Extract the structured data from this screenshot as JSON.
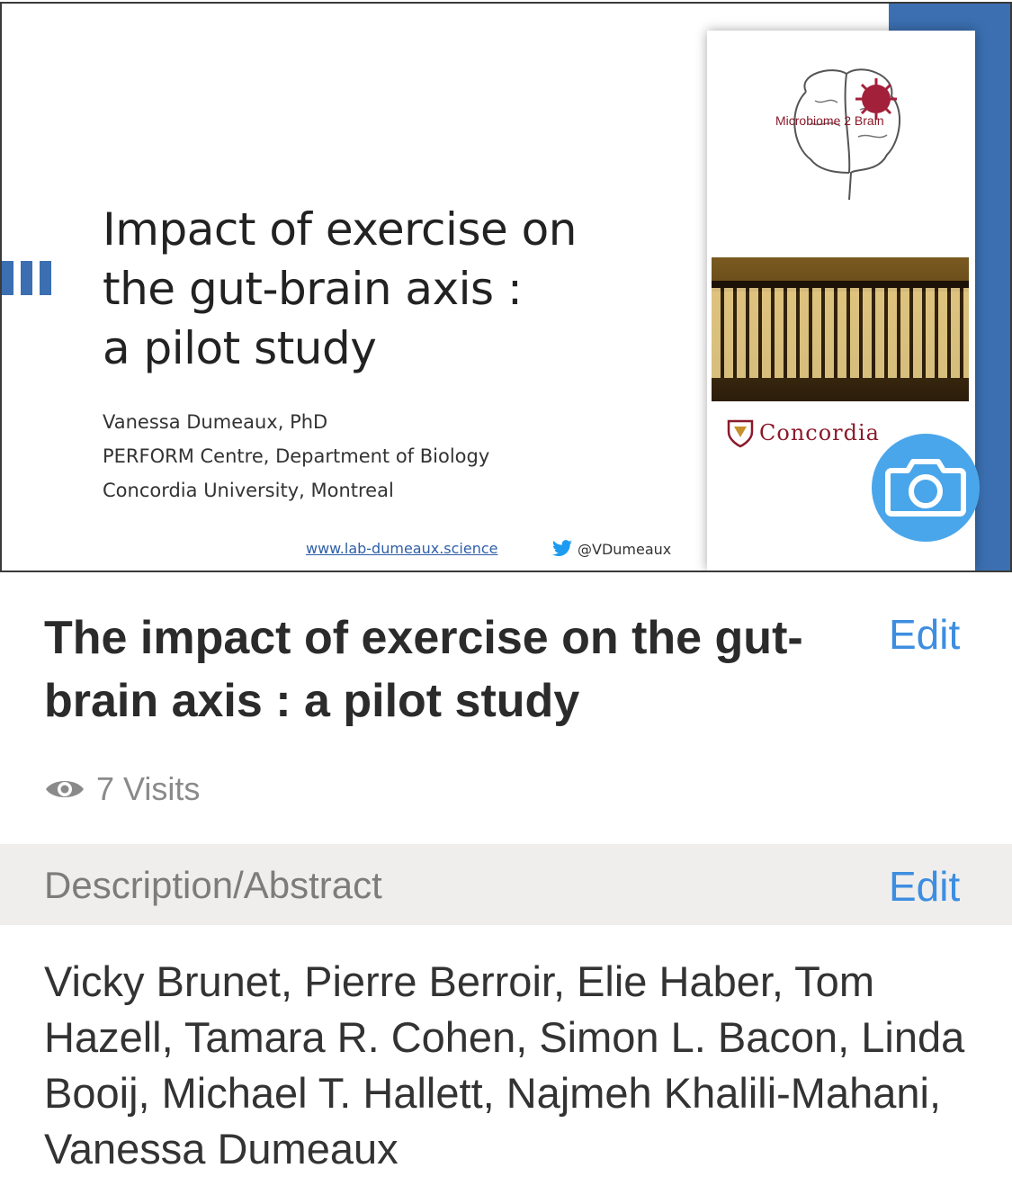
{
  "slide": {
    "title_lines": [
      "Impact of exercise on",
      "the gut-brain axis :",
      "a pilot study"
    ],
    "info_lines": [
      "Vanessa Dumeaux, PhD",
      "PERFORM Centre, Department of Biology",
      "Concordia University, Montreal"
    ],
    "website": "www.lab-dumeaux.science",
    "twitter": "@VDumeaux",
    "logo_caption": "Microbiome 2 Brain",
    "university": "Concordia"
  },
  "document": {
    "title": "The impact of exercise on the gut-brain axis : a pilot study",
    "edit_label": "Edit",
    "visits": "7 Visits"
  },
  "description": {
    "section_label": "Description/Abstract",
    "edit_label": "Edit",
    "authors": "Vicky Brunet, Pierre Berroir, Elie Haber, Tom Hazell, Tamara R. Cohen, Simon L. Bacon, Linda Booij, Michael T. Hallett, Najmeh Khalili-Mahani, Vanessa Dumeaux"
  },
  "colors": {
    "accent": "#3d8ee0",
    "camera": "#4aa6ea",
    "slide_blue": "#3b6fb1",
    "section_bg": "#efeeed"
  },
  "icons": [
    "camera-icon",
    "eye-icon",
    "twitter-bird-icon",
    "brain-icon"
  ]
}
